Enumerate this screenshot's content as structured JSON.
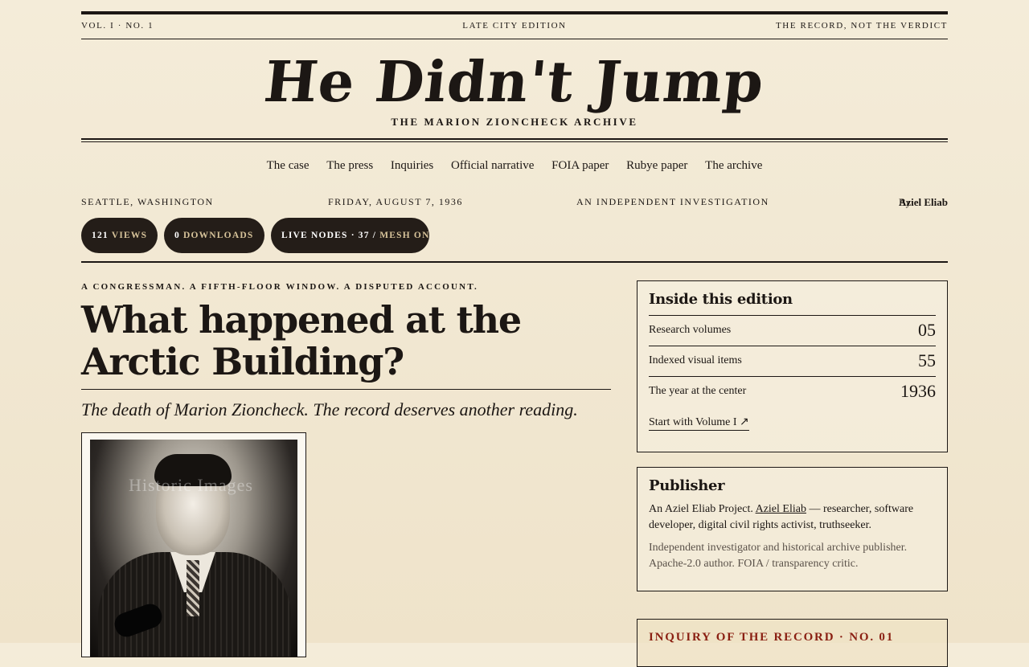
{
  "edition_bar": {
    "left": "VOL. I · NO. 1",
    "center": "LATE CITY EDITION",
    "right": "THE RECORD, NOT THE VERDICT"
  },
  "masthead": {
    "title": "He Didn't Jump",
    "subtitle": "THE MARION ZIONCHECK ARCHIVE"
  },
  "nav": {
    "items": [
      "The case",
      "The press",
      "Inquiries",
      "Official narrative",
      "FOIA paper",
      "Rubye paper",
      "The archive"
    ]
  },
  "dateline": {
    "place": "SEATTLE, WASHINGTON",
    "date": "FRIDAY, AUGUST 7, 1936",
    "tagline": "AN INDEPENDENT INVESTIGATION",
    "byline_prefix": "By",
    "byline_name": "Aziel Eliab"
  },
  "stats_pills": {
    "views_count": "121",
    "views_label": "VIEWS",
    "downloads_count": "0",
    "downloads_label": "DOWNLOADS",
    "nodes_label": "LIVE NODES · 37 /",
    "mesh_label": "MESH ON"
  },
  "article": {
    "kicker": "A CONGRESSMAN. A FIFTH-FLOOR WINDOW. A DISPUTED ACCOUNT.",
    "headline": "What happened at the Arctic Building?",
    "dek": "The death of Marion Zioncheck. The record deserves another reading.",
    "photo_watermark": "Historic Images"
  },
  "inside_edition": {
    "title": "Inside this edition",
    "stats": [
      {
        "label": "Research volumes",
        "value": "05"
      },
      {
        "label": "Indexed visual items",
        "value": "55"
      },
      {
        "label": "The year at the center",
        "value": "1936"
      }
    ],
    "link_label": "Start with Volume I ↗"
  },
  "publisher": {
    "title": "Publisher",
    "intro": "An Aziel Eliab Project.",
    "name_link": "Aziel Eliab",
    "description": "— researcher, software developer, digital civil rights activist, truthseeker.",
    "sub": "Independent investigator and historical archive publisher. Apache-2.0 author. FOIA / transparency critic."
  },
  "inquiry": {
    "title": "INQUIRY OF THE RECORD · NO. 01"
  },
  "colors": {
    "paper": "#f2e8d3",
    "ink": "#1c1714",
    "pill_bg": "#241d18",
    "accent_red": "#8a1f12"
  }
}
